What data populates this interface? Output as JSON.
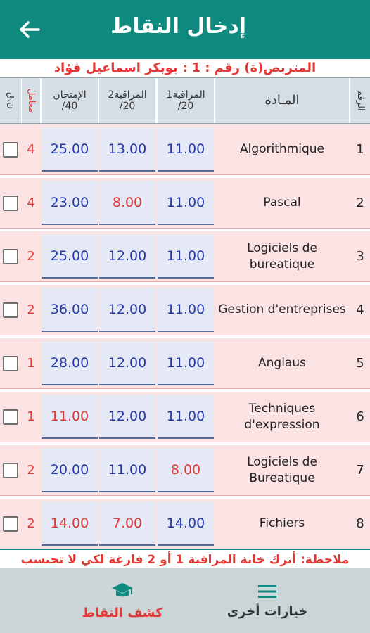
{
  "header": {
    "title": "إدخال النقاط"
  },
  "student_line": "المتربص(ة) رقم : 1 : بوبكر اسماعيل فؤاد",
  "table": {
    "headers": {
      "num": "الرقم",
      "subject": "المـادة",
      "m1_line1": "المراقبة1",
      "m1_line2": "/20",
      "m2_line1": "المراقبة2",
      "m2_line2": "/20",
      "exam_line1": "الإمتحان",
      "exam_line2": "/40",
      "coef": "معامل",
      "chk": "ن.ق"
    },
    "rows": [
      {
        "num": "1",
        "subject": "Algorithmique",
        "m1": "11.00",
        "m2": "13.00",
        "exam": "25.00",
        "coef": "4",
        "m1_color": "blue",
        "m2_color": "blue",
        "exam_color": "blue"
      },
      {
        "num": "2",
        "subject": "Pascal",
        "m1": "11.00",
        "m2": "8.00",
        "exam": "23.00",
        "coef": "4",
        "m1_color": "blue",
        "m2_color": "red",
        "exam_color": "blue"
      },
      {
        "num": "3",
        "subject": "Logiciels de bureatique",
        "m1": "11.00",
        "m2": "12.00",
        "exam": "25.00",
        "coef": "2",
        "m1_color": "blue",
        "m2_color": "blue",
        "exam_color": "blue"
      },
      {
        "num": "4",
        "subject": "Gestion d'entreprises",
        "m1": "11.00",
        "m2": "12.00",
        "exam": "36.00",
        "coef": "2",
        "m1_color": "blue",
        "m2_color": "blue",
        "exam_color": "blue"
      },
      {
        "num": "5",
        "subject": "Anglaus",
        "m1": "11.00",
        "m2": "12.00",
        "exam": "28.00",
        "coef": "1",
        "m1_color": "blue",
        "m2_color": "blue",
        "exam_color": "blue"
      },
      {
        "num": "6",
        "subject": "Techniques d'expression",
        "m1": "11.00",
        "m2": "12.00",
        "exam": "11.00",
        "coef": "1",
        "m1_color": "blue",
        "m2_color": "blue",
        "exam_color": "red"
      },
      {
        "num": "7",
        "subject": "Logiciels de Bureatique",
        "m1": "8.00",
        "m2": "11.00",
        "exam": "20.00",
        "coef": "2",
        "m1_color": "red",
        "m2_color": "blue",
        "exam_color": "blue"
      },
      {
        "num": "8",
        "subject": "Fichiers",
        "m1": "14.00",
        "m2": "7.00",
        "exam": "14.00",
        "coef": "2",
        "m1_color": "blue",
        "m2_color": "red",
        "exam_color": "red"
      }
    ]
  },
  "note": "ملاحظة: أترك خانة المراقبة 1 أو 2 فارغة لكي لا تحتسب",
  "bottom_nav": {
    "grades_label": "كشف النقاط",
    "grades_icon": "graduation-cap-icon",
    "more_label": "خيارات أخرى",
    "more_icon": "menu-icon"
  },
  "colors": {
    "primary": "#0f8a7e",
    "accent_red": "#e53935",
    "grade_blue": "#2639a8",
    "row_bg": "#fbe3e3",
    "grade_cell_bg": "#e4e9f5"
  }
}
